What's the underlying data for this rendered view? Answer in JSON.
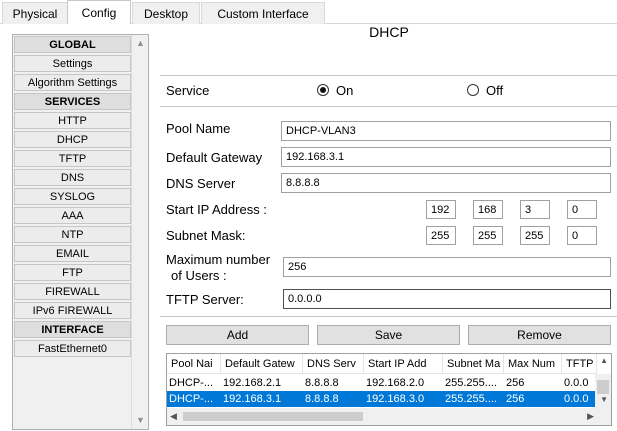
{
  "tabs": [
    "Physical",
    "Config",
    "Desktop",
    "Custom Interface"
  ],
  "sidebar": {
    "items": [
      {
        "label": "GLOBAL",
        "header": true
      },
      {
        "label": "Settings"
      },
      {
        "label": "Algorithm Settings"
      },
      {
        "label": "SERVICES",
        "header": true
      },
      {
        "label": "HTTP"
      },
      {
        "label": "DHCP"
      },
      {
        "label": "TFTP"
      },
      {
        "label": "DNS"
      },
      {
        "label": "SYSLOG"
      },
      {
        "label": "AAA"
      },
      {
        "label": "NTP"
      },
      {
        "label": "EMAIL"
      },
      {
        "label": "FTP"
      },
      {
        "label": "FIREWALL"
      },
      {
        "label": "IPv6 FIREWALL"
      },
      {
        "label": "INTERFACE",
        "header": true
      },
      {
        "label": "FastEthernet0"
      }
    ]
  },
  "panel": {
    "title": "DHCP",
    "service_label": "Service",
    "on_label": "On",
    "off_label": "Off",
    "service_on": true
  },
  "form": {
    "pool_name_label": "Pool Name",
    "pool_name": "DHCP-VLAN3",
    "gateway_label": "Default Gateway",
    "gateway": "192.168.3.1",
    "dns_label": "DNS Server",
    "dns": "8.8.8.8",
    "start_ip_label": "Start IP Address :",
    "start_ip": [
      "192",
      "168",
      "3",
      "0"
    ],
    "mask_label": "Subnet Mask:",
    "mask": [
      "255",
      "255",
      "255",
      "0"
    ],
    "max_users_label_1": "Maximum number",
    "max_users_label_2": "of Users :",
    "max_users": "256",
    "tftp_label": "TFTP Server:",
    "tftp": "0.0.0.0"
  },
  "buttons": {
    "add": "Add",
    "save": "Save",
    "remove": "Remove"
  },
  "table": {
    "headers": [
      "Pool Nai",
      "Default Gatew",
      "DNS Serv",
      "Start IP Add",
      "Subnet Ma",
      "Max Num",
      "TFTP"
    ],
    "rows": [
      [
        "DHCP-...",
        "192.168.2.1",
        "8.8.8.8",
        "192.168.2.0",
        "255.255....",
        "256",
        "0.0.0"
      ],
      [
        "DHCP-...",
        "192.168.3.1",
        "8.8.8.8",
        "192.168.3.0",
        "255.255....",
        "256",
        "0.0.0"
      ]
    ],
    "selected_row": 1
  },
  "colors": {
    "selection": "#0078d7"
  }
}
